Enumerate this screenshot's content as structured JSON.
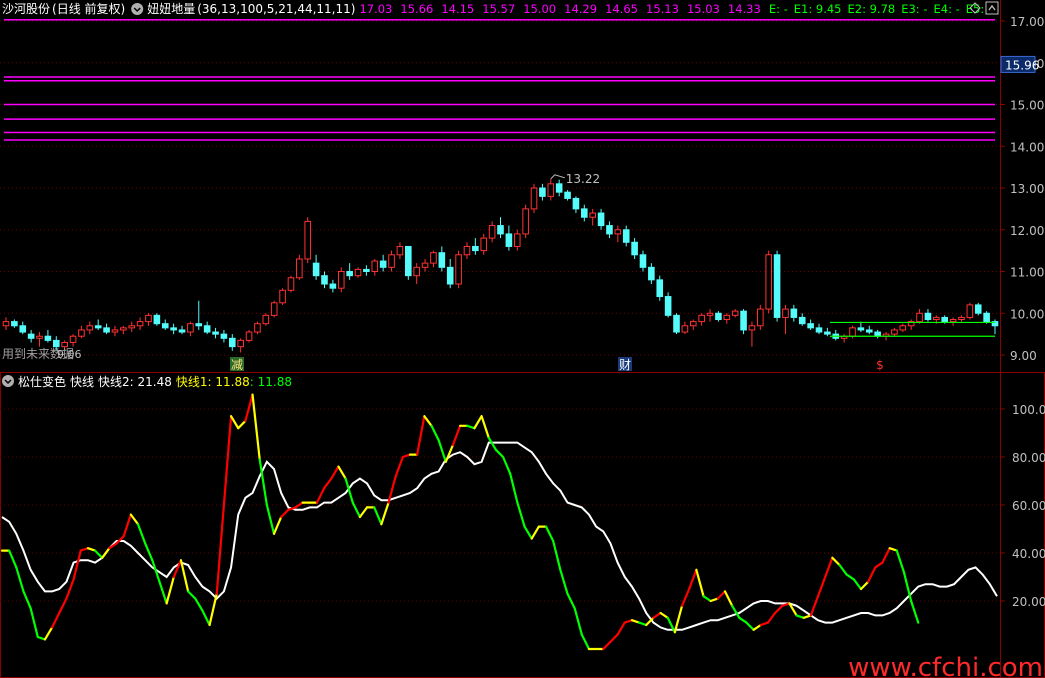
{
  "colors": {
    "bg": "#000000",
    "frame": "#8b0000",
    "grid": "#6a0000",
    "up": "#ff3232",
    "down": "#54fcfc",
    "magenta": "#ff00ff",
    "white": "#ffffff",
    "yellow": "#ffff00",
    "green": "#00ff00",
    "red": "#ff0000",
    "axis_text": "#c0c0c0"
  },
  "header": {
    "stock_name": "沙河股份",
    "period": "(日线 前复权)",
    "circle_icon": "circle-chevron-icon",
    "indicator_name": "妞妞地量",
    "indicator_params": "(36,13,100,5,21,44,11,11)",
    "values": [
      "17.03",
      "15.66",
      "14.15",
      "15.57",
      "15.00",
      "14.29",
      "14.65",
      "15.13",
      "15.03",
      "14.33"
    ],
    "e_labels": [
      "E: -",
      "E1: 9.45",
      "E2: 9.78",
      "E3: -",
      "E4: -",
      "E5:"
    ],
    "corner_buttons": [
      "up-icon",
      "diamond-icon"
    ]
  },
  "sub_header": {
    "name": "松仕变色",
    "line_label": "快线",
    "fast2_label": "快线2: 21.48",
    "fast1_label": "快线1: 11.88",
    "fast1_value2": ": 11.88"
  },
  "overlay_text": {
    "left_note": "用到未来数据",
    "low_label": "9.06",
    "high_label": "13.22",
    "current_price": "15.96",
    "markers": [
      "减",
      "财",
      "$"
    ],
    "watermark": "www.cfchi.com"
  },
  "chart_data": [
    {
      "type": "candlestick",
      "title": "沙河股份 (日线 前复权)",
      "ylim": [
        8.8,
        17.4
      ],
      "y_ticks": [
        "17.00",
        "16.00",
        "15.00",
        "14.00",
        "13.00",
        "12.00",
        "11.00",
        "10.00",
        "9.00"
      ],
      "magenta_levels": [
        17.03,
        15.66,
        15.57,
        15.0,
        14.65,
        14.33,
        14.15
      ],
      "green_levels": [
        9.45,
        9.78
      ],
      "annotations": {
        "high": 13.22,
        "low": 9.06,
        "current": 15.96
      },
      "candles": [
        [
          9.7,
          9.9,
          9.6,
          9.8
        ],
        [
          9.8,
          9.85,
          9.65,
          9.7
        ],
        [
          9.7,
          9.8,
          9.5,
          9.55
        ],
        [
          9.5,
          9.6,
          9.3,
          9.4
        ],
        [
          9.4,
          9.55,
          9.2,
          9.45
        ],
        [
          9.45,
          9.6,
          9.3,
          9.35
        ],
        [
          9.35,
          9.45,
          9.1,
          9.2
        ],
        [
          9.2,
          9.35,
          9.1,
          9.3
        ],
        [
          9.3,
          9.5,
          9.2,
          9.45
        ],
        [
          9.45,
          9.7,
          9.4,
          9.6
        ],
        [
          9.6,
          9.8,
          9.5,
          9.7
        ],
        [
          9.7,
          9.85,
          9.6,
          9.65
        ],
        [
          9.65,
          9.75,
          9.5,
          9.55
        ],
        [
          9.55,
          9.7,
          9.45,
          9.6
        ],
        [
          9.6,
          9.7,
          9.5,
          9.65
        ],
        [
          9.65,
          9.8,
          9.55,
          9.7
        ],
        [
          9.7,
          9.9,
          9.6,
          9.8
        ],
        [
          9.8,
          10.0,
          9.7,
          9.95
        ],
        [
          9.95,
          10.0,
          9.7,
          9.75
        ],
        [
          9.75,
          9.85,
          9.6,
          9.65
        ],
        [
          9.65,
          9.75,
          9.5,
          9.6
        ],
        [
          9.6,
          9.7,
          9.5,
          9.55
        ],
        [
          9.55,
          9.8,
          9.45,
          9.75
        ],
        [
          9.75,
          10.3,
          9.6,
          9.7
        ],
        [
          9.7,
          9.8,
          9.5,
          9.55
        ],
        [
          9.55,
          9.65,
          9.4,
          9.5
        ],
        [
          9.5,
          9.6,
          9.3,
          9.4
        ],
        [
          9.4,
          9.5,
          9.1,
          9.2
        ],
        [
          9.2,
          9.4,
          9.06,
          9.35
        ],
        [
          9.35,
          9.6,
          9.3,
          9.55
        ],
        [
          9.55,
          9.8,
          9.5,
          9.75
        ],
        [
          9.75,
          10.0,
          9.7,
          9.95
        ],
        [
          9.95,
          10.3,
          9.9,
          10.25
        ],
        [
          10.25,
          10.6,
          10.2,
          10.55
        ],
        [
          10.55,
          10.9,
          10.5,
          10.85
        ],
        [
          10.85,
          11.4,
          10.8,
          11.3
        ],
        [
          11.3,
          12.3,
          11.2,
          12.2
        ],
        [
          11.2,
          11.4,
          10.8,
          10.9
        ],
        [
          10.9,
          11.0,
          10.6,
          10.7
        ],
        [
          10.7,
          10.8,
          10.5,
          10.6
        ],
        [
          10.6,
          11.1,
          10.5,
          11.0
        ],
        [
          11.0,
          11.2,
          10.8,
          10.9
        ],
        [
          10.9,
          11.1,
          10.85,
          11.05
        ],
        [
          11.05,
          11.15,
          10.9,
          11.0
        ],
        [
          11.0,
          11.3,
          10.9,
          11.25
        ],
        [
          11.25,
          11.4,
          11.0,
          11.1
        ],
        [
          11.1,
          11.5,
          11.0,
          11.4
        ],
        [
          11.4,
          11.7,
          11.3,
          11.6
        ],
        [
          11.6,
          11.6,
          10.8,
          10.9
        ],
        [
          10.9,
          11.2,
          10.7,
          11.1
        ],
        [
          11.1,
          11.3,
          11.0,
          11.2
        ],
        [
          11.2,
          11.5,
          11.1,
          11.45
        ],
        [
          11.45,
          11.6,
          11.0,
          11.1
        ],
        [
          11.1,
          11.3,
          10.6,
          10.7
        ],
        [
          10.7,
          11.5,
          10.6,
          11.4
        ],
        [
          11.4,
          11.7,
          11.3,
          11.6
        ],
        [
          11.6,
          11.8,
          11.4,
          11.5
        ],
        [
          11.5,
          11.9,
          11.4,
          11.8
        ],
        [
          11.8,
          12.2,
          11.7,
          12.1
        ],
        [
          12.1,
          12.3,
          11.8,
          11.9
        ],
        [
          11.9,
          12.1,
          11.5,
          11.6
        ],
        [
          11.6,
          12.0,
          11.5,
          11.9
        ],
        [
          11.9,
          12.6,
          11.8,
          12.5
        ],
        [
          12.5,
          13.1,
          12.4,
          13.0
        ],
        [
          13.0,
          13.1,
          12.7,
          12.8
        ],
        [
          12.8,
          13.22,
          12.7,
          13.1
        ],
        [
          13.1,
          13.2,
          12.8,
          12.9
        ],
        [
          12.9,
          12.95,
          12.7,
          12.75
        ],
        [
          12.75,
          12.8,
          12.4,
          12.5
        ],
        [
          12.5,
          12.6,
          12.2,
          12.3
        ],
        [
          12.3,
          12.5,
          12.1,
          12.4
        ],
        [
          12.4,
          12.5,
          12.0,
          12.1
        ],
        [
          12.1,
          12.2,
          11.8,
          11.9
        ],
        [
          11.9,
          12.1,
          11.7,
          12.0
        ],
        [
          12.0,
          12.1,
          11.6,
          11.7
        ],
        [
          11.7,
          11.8,
          11.3,
          11.4
        ],
        [
          11.4,
          11.5,
          11.0,
          11.1
        ],
        [
          11.1,
          11.2,
          10.7,
          10.8
        ],
        [
          10.8,
          10.9,
          10.3,
          10.4
        ],
        [
          10.4,
          10.5,
          9.9,
          9.95
        ],
        [
          9.95,
          10.0,
          9.5,
          9.55
        ],
        [
          9.55,
          9.8,
          9.5,
          9.7
        ],
        [
          9.7,
          9.85,
          9.6,
          9.8
        ],
        [
          9.8,
          10.0,
          9.7,
          9.95
        ],
        [
          9.95,
          10.1,
          9.8,
          10.0
        ],
        [
          10.0,
          10.05,
          9.8,
          9.85
        ],
        [
          9.85,
          10.0,
          9.75,
          9.95
        ],
        [
          9.95,
          10.1,
          9.9,
          10.05
        ],
        [
          10.05,
          10.1,
          9.5,
          9.6
        ],
        [
          9.6,
          9.8,
          9.2,
          9.7
        ],
        [
          9.7,
          10.2,
          9.6,
          10.1
        ],
        [
          10.1,
          11.5,
          10.0,
          11.4
        ],
        [
          11.4,
          11.5,
          9.8,
          9.9
        ],
        [
          9.9,
          10.2,
          9.5,
          10.1
        ],
        [
          10.1,
          10.2,
          9.8,
          9.9
        ],
        [
          9.9,
          10.0,
          9.7,
          9.75
        ],
        [
          9.75,
          9.85,
          9.6,
          9.65
        ],
        [
          9.65,
          9.75,
          9.5,
          9.55
        ],
        [
          9.55,
          9.65,
          9.45,
          9.5
        ],
        [
          9.5,
          9.6,
          9.35,
          9.4
        ],
        [
          9.4,
          9.5,
          9.3,
          9.45
        ],
        [
          9.45,
          9.7,
          9.4,
          9.65
        ],
        [
          9.65,
          9.8,
          9.55,
          9.6
        ],
        [
          9.6,
          9.7,
          9.5,
          9.55
        ],
        [
          9.55,
          9.6,
          9.4,
          9.45
        ],
        [
          9.45,
          9.55,
          9.35,
          9.5
        ],
        [
          9.5,
          9.65,
          9.45,
          9.6
        ],
        [
          9.6,
          9.75,
          9.55,
          9.7
        ],
        [
          9.7,
          9.85,
          9.6,
          9.8
        ],
        [
          9.8,
          10.1,
          9.75,
          10.0
        ],
        [
          10.0,
          10.1,
          9.8,
          9.85
        ],
        [
          9.85,
          9.95,
          9.75,
          9.9
        ],
        [
          9.9,
          9.95,
          9.75,
          9.8
        ],
        [
          9.8,
          9.9,
          9.7,
          9.85
        ],
        [
          9.85,
          9.95,
          9.8,
          9.9
        ],
        [
          9.9,
          10.25,
          9.85,
          10.2
        ],
        [
          10.2,
          10.25,
          9.95,
          10.0
        ],
        [
          10.0,
          10.05,
          9.75,
          9.8
        ],
        [
          9.8,
          9.85,
          9.5,
          9.7
        ]
      ]
    },
    {
      "type": "line",
      "title": "松仕变色",
      "ylim": [
        0,
        112
      ],
      "y_ticks": [
        "100.00",
        "80.00",
        "60.00",
        "40.00",
        "20.00"
      ],
      "series": [
        {
          "name": "快线2",
          "color": "white",
          "values": [
            55,
            53,
            48,
            41,
            33,
            28,
            24,
            24,
            25,
            28,
            36,
            37,
            37,
            36,
            38,
            42,
            45,
            45,
            43,
            40,
            37,
            34,
            32,
            30,
            34,
            36,
            35,
            30,
            26,
            24,
            21,
            24,
            34,
            56,
            63,
            65,
            72,
            78,
            75,
            65,
            59,
            58,
            58,
            59,
            59,
            61,
            61,
            63,
            65,
            69,
            71,
            69,
            64,
            62,
            62,
            63,
            64,
            65,
            67,
            71,
            73,
            74,
            79,
            81,
            82,
            80,
            77,
            78,
            86,
            86,
            86,
            86,
            86,
            84,
            82,
            78,
            73,
            69,
            66,
            61,
            60,
            59,
            56,
            51,
            49,
            44,
            36,
            30,
            26,
            21,
            15,
            11,
            9,
            8,
            8,
            8,
            9,
            10,
            11,
            12,
            12,
            13,
            14,
            15,
            17,
            19,
            20,
            20,
            19,
            19,
            19,
            18,
            16,
            14,
            12,
            11,
            11,
            12,
            13,
            14,
            15,
            15,
            14,
            14,
            15,
            17,
            20,
            23,
            26,
            27,
            27,
            26,
            26,
            27,
            30,
            33,
            34,
            31,
            27,
            22
          ]
        },
        {
          "name": "快线1",
          "values": [
            41,
            41,
            34,
            24,
            17,
            5,
            4,
            9,
            15,
            21,
            29,
            41,
            42,
            41,
            38,
            42,
            44,
            47,
            56,
            52,
            44,
            37,
            28,
            19,
            30,
            37,
            24,
            21,
            16,
            10,
            23,
            60,
            97,
            92,
            95,
            106,
            79,
            60,
            48,
            55,
            58,
            59,
            61,
            61,
            61,
            67,
            71,
            76,
            71,
            61,
            55,
            59,
            59,
            52,
            61,
            72,
            80,
            81,
            81,
            97,
            93,
            87,
            78,
            85,
            93,
            93,
            92,
            97,
            88,
            83,
            80,
            73,
            61,
            51,
            46,
            51,
            51,
            45,
            33,
            23,
            17,
            6,
            0,
            0,
            0,
            3,
            6,
            11,
            12,
            11,
            10,
            13,
            15,
            13,
            7,
            18,
            25,
            33,
            22,
            20,
            21,
            24,
            18,
            13,
            11,
            8,
            10,
            11,
            15,
            18,
            19,
            14,
            13,
            14,
            22,
            30,
            38,
            35,
            31,
            29,
            25,
            28,
            34,
            36,
            42,
            41,
            32,
            20,
            11
          ]
        }
      ],
      "fast_color_segments": "red=rising,yellow=turning,green=falling"
    }
  ]
}
